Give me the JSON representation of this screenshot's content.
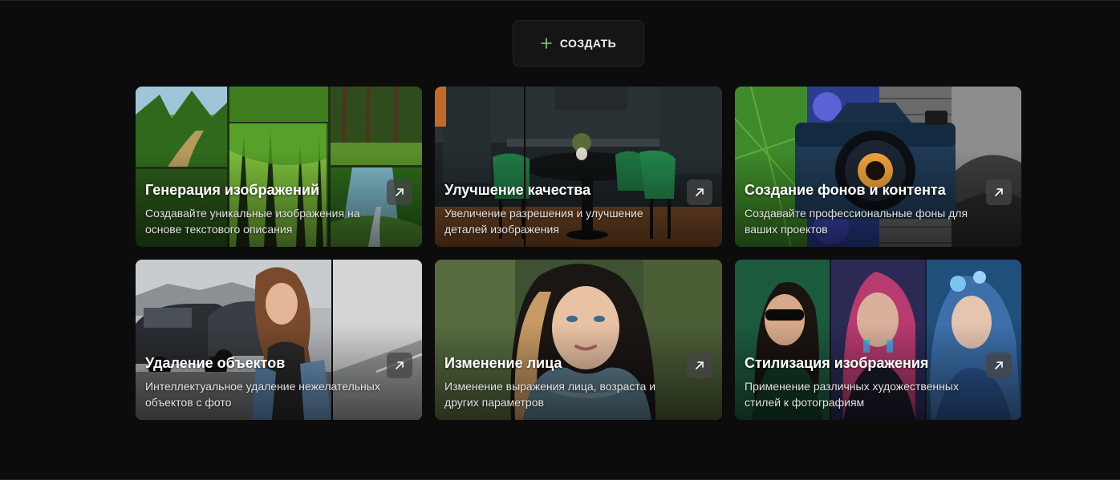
{
  "header": {
    "create_label": "СОЗДАТЬ",
    "plus_icon": "plus-icon",
    "accent": "#7fd07f"
  },
  "cards": [
    {
      "title": "Генерация изображений",
      "description": "Создавайте уникальные изображения на основе текстового описания",
      "icon": "arrow-up-right-icon"
    },
    {
      "title": "Улучшение качества",
      "description": "Увеличение разрешения и улучшение деталей изображения",
      "icon": "arrow-up-right-icon"
    },
    {
      "title": "Создание фонов и контента",
      "description": "Создавайте профессиональные фоны для ваших проектов",
      "icon": "arrow-up-right-icon"
    },
    {
      "title": "Удаление объектов",
      "description": "Интеллектуальное удаление нежелательных объектов с фото",
      "icon": "arrow-up-right-icon"
    },
    {
      "title": "Изменение лица",
      "description": "Изменение выражения лица, возраста и других параметров",
      "icon": "arrow-up-right-icon"
    },
    {
      "title": "Стилизация изображения",
      "description": "Применение различных художественных стилей к фотографиям",
      "icon": "arrow-up-right-icon"
    }
  ]
}
